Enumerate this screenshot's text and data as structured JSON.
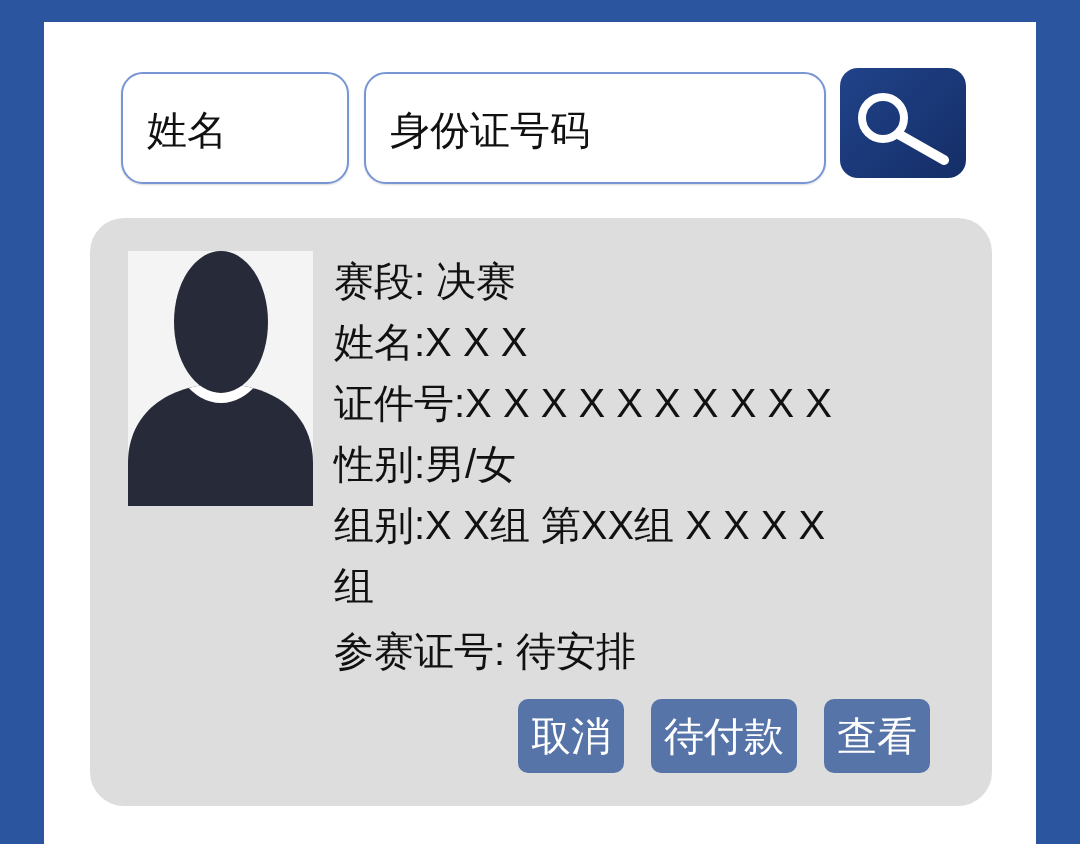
{
  "search": {
    "fields": [
      {
        "placeholder": "姓名"
      },
      {
        "placeholder": "身份证号码"
      }
    ]
  },
  "result_card": {
    "info_lines": [
      "赛段: 决赛",
      "姓名:X X X",
      "证件号:X X X X X X X X X X",
      "性别:男/女",
      "组别:X X组 第XX组 X X X X组",
      "参赛证号: 待安排"
    ],
    "buttons": [
      "取消",
      "待付款",
      "查看"
    ]
  }
}
